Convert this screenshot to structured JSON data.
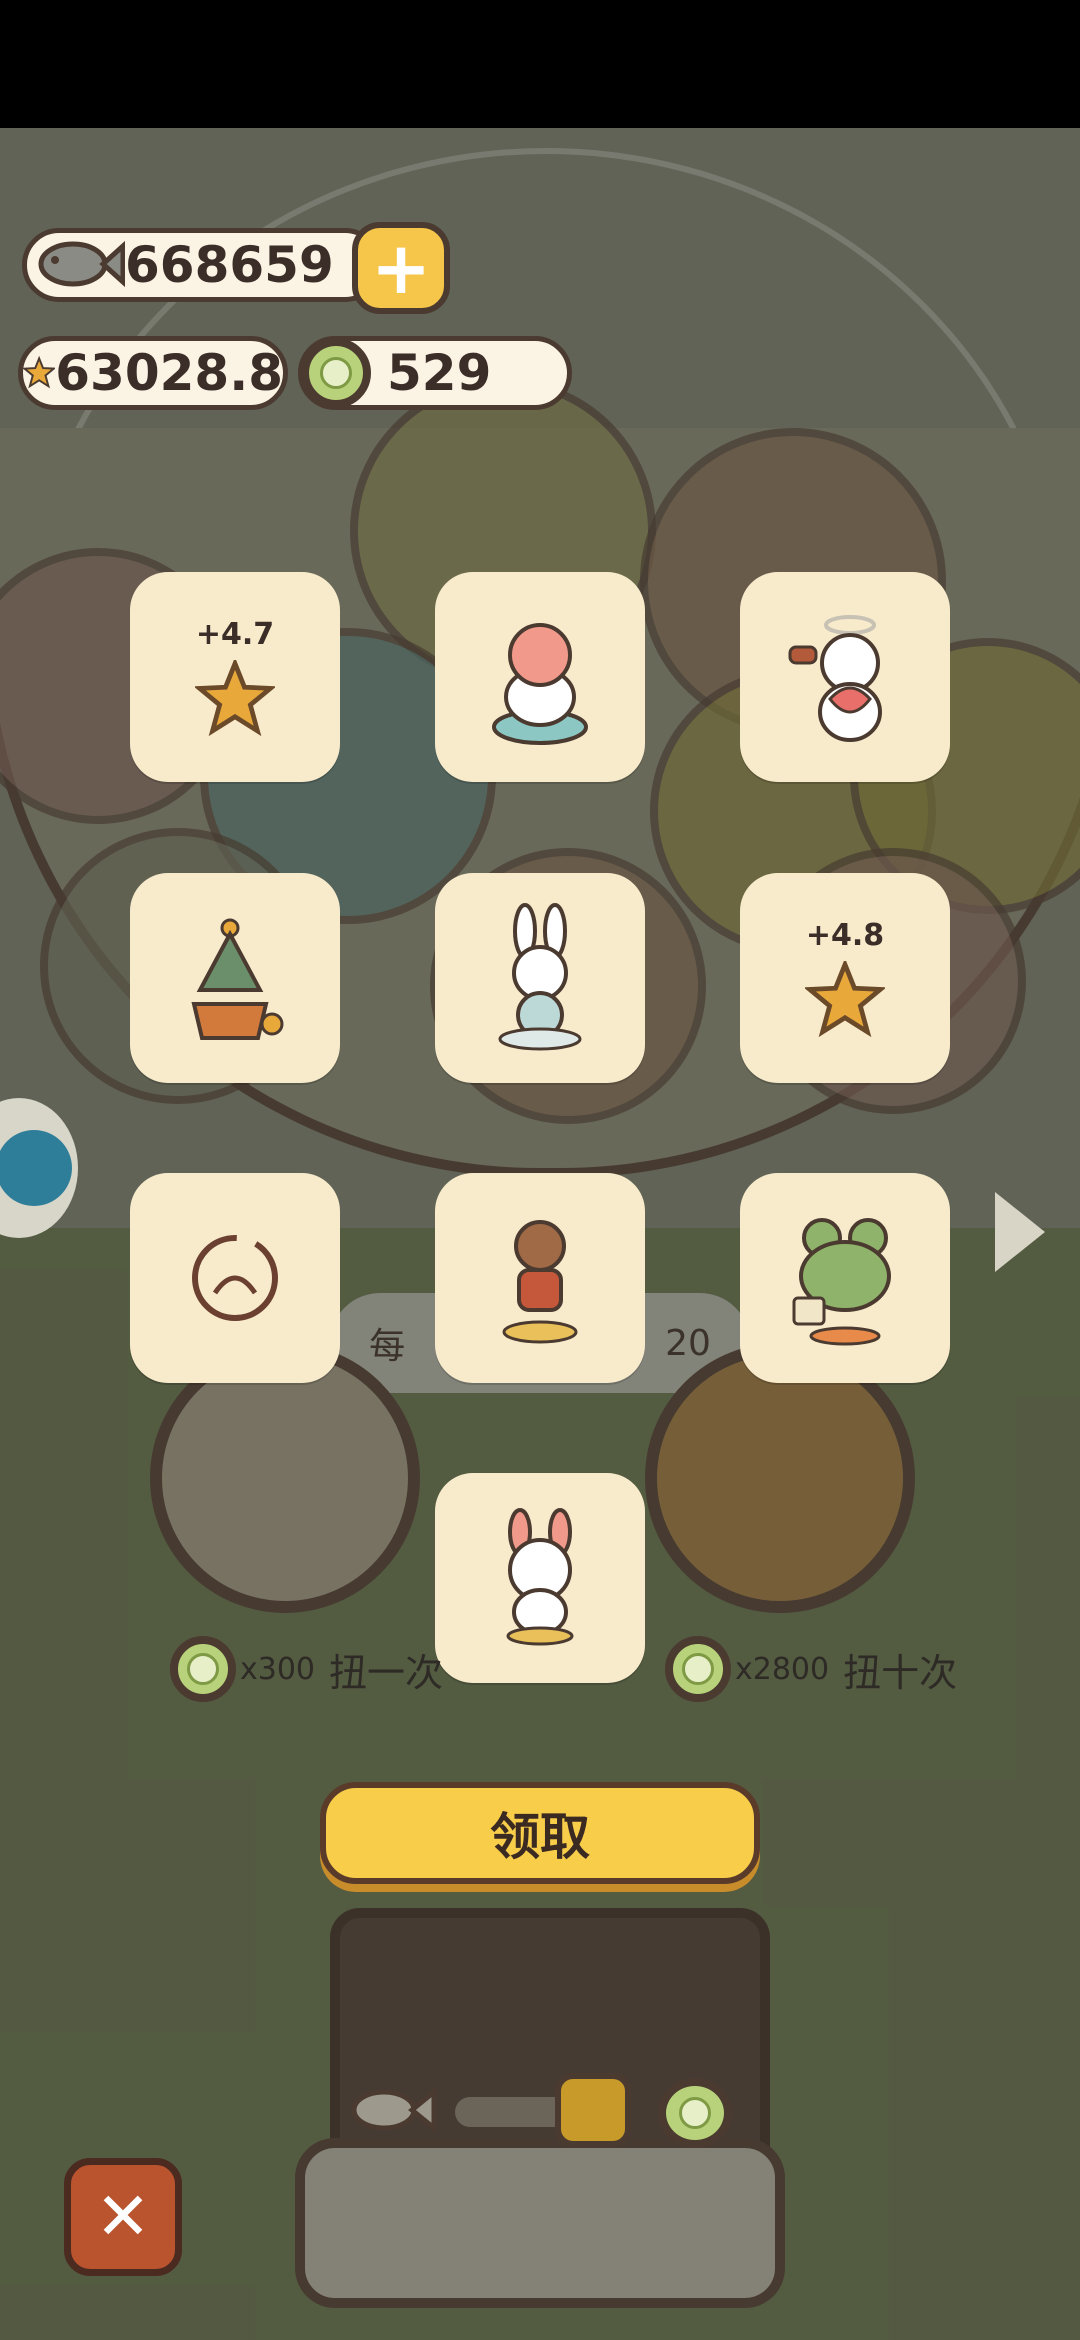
{
  "currency": {
    "fish": "668659",
    "star": "63028.8",
    "coin": "529"
  },
  "rewards": [
    {
      "type": "star",
      "amount": "+4.7",
      "icon": "star-icon"
    },
    {
      "type": "figure",
      "amount": "",
      "icon": "pig-figure-icon"
    },
    {
      "type": "figure",
      "amount": "",
      "icon": "angel-figure-icon"
    },
    {
      "type": "figure",
      "amount": "",
      "icon": "tree-figure-icon"
    },
    {
      "type": "figure",
      "amount": "",
      "icon": "bunny-figure-icon"
    },
    {
      "type": "star",
      "amount": "+4.8",
      "icon": "star-icon"
    },
    {
      "type": "figure",
      "amount": "",
      "icon": "circle-sketch-icon"
    },
    {
      "type": "figure",
      "amount": "",
      "icon": "boy-figure-icon"
    },
    {
      "type": "figure",
      "amount": "",
      "icon": "frog-figure-icon"
    },
    {
      "type": "figure",
      "amount": "",
      "icon": "puppy-figure-icon"
    }
  ],
  "daily_banner": {
    "left": "每",
    "right": "20"
  },
  "spin_once": {
    "cost": "x300",
    "label": "扭一次"
  },
  "spin_ten": {
    "cost": "x2800",
    "label": "扭十次"
  },
  "claim_button": "领取",
  "close_button": "✕",
  "colors": {
    "accent": "#f8cd4a",
    "card": "#f8ebcc",
    "outline": "#4b3a30"
  }
}
